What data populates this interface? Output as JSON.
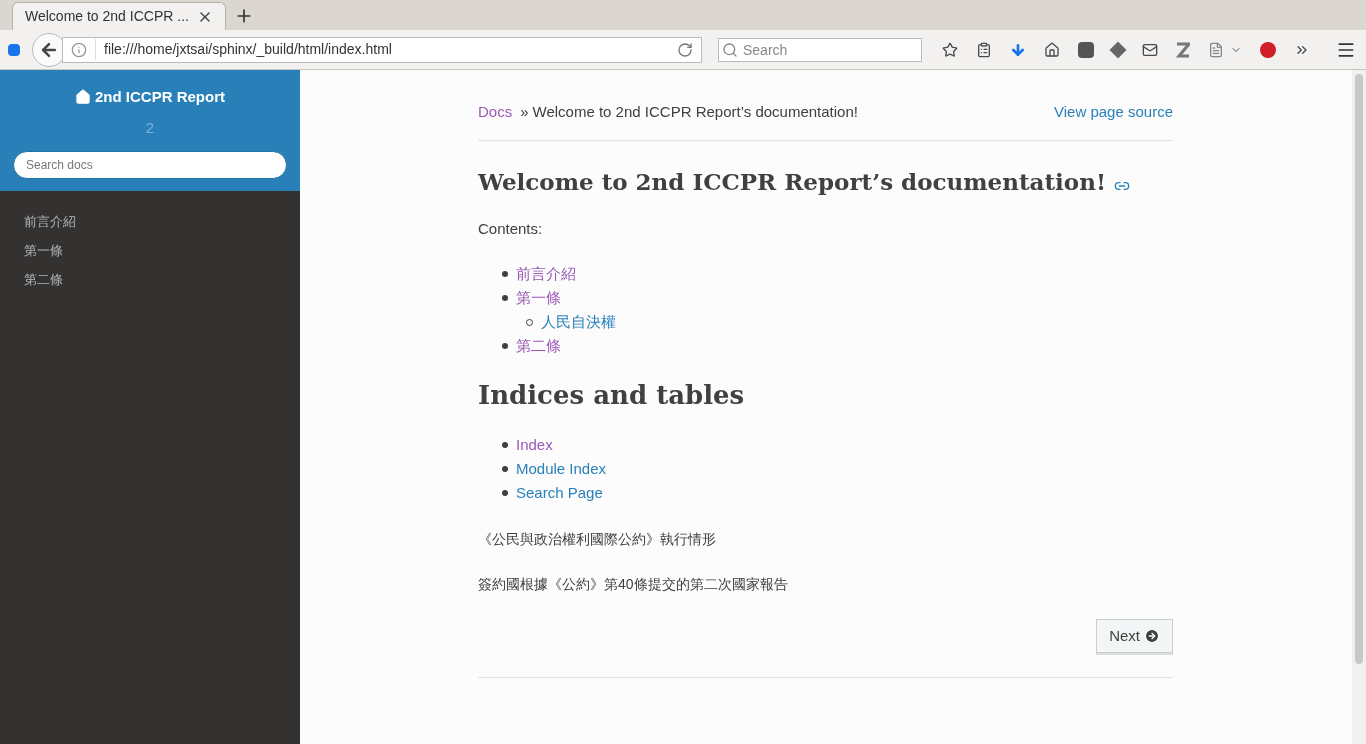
{
  "browser": {
    "tab": {
      "title": "Welcome to 2nd ICCPR ...",
      "selected": true
    },
    "url": "file:///home/jxtsai/sphinx/_build/html/index.html",
    "search": {
      "placeholder": "Search"
    }
  },
  "sidebar": {
    "project": "2nd ICCPR Report",
    "version": "2",
    "search": {
      "placeholder": "Search docs"
    },
    "items": [
      {
        "label": "前言介紹"
      },
      {
        "label": "第一條"
      },
      {
        "label": "第二條"
      }
    ]
  },
  "breadcrumbs": {
    "root": {
      "label": "Docs",
      "visited": true
    },
    "separator": "»",
    "current": "Welcome to 2nd ICCPR Report’s documentation!",
    "source_link": "View page source"
  },
  "title": "Welcome to 2nd ICCPR Report’s documentation!",
  "contents_label": "Contents:",
  "toc": [
    {
      "label": "前言介紹",
      "visited": true
    },
    {
      "label": "第一條",
      "visited": true,
      "children": [
        {
          "label": "人民自決權",
          "visited": false
        }
      ]
    },
    {
      "label": "第二條",
      "visited": true
    }
  ],
  "indices_heading": "Indices and tables",
  "indices": [
    {
      "label": "Index",
      "visited": true
    },
    {
      "label": "Module Index",
      "visited": false
    },
    {
      "label": "Search Page",
      "visited": false
    }
  ],
  "paragraphs": [
    "《公民與政治權利國際公約》執行情形",
    "簽約國根據《公約》第40條提交的第二次國家報告"
  ],
  "next_button": "Next"
}
